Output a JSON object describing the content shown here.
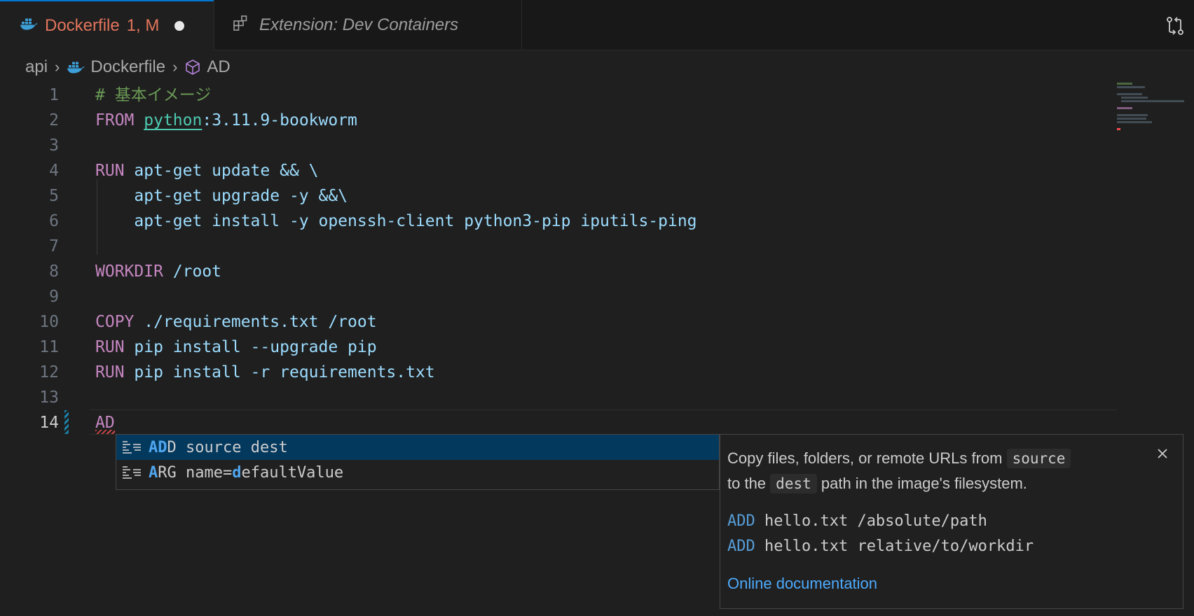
{
  "tabs": [
    {
      "title": "Dockerfile",
      "status": "1, M",
      "icon": "docker-icon",
      "active": true
    },
    {
      "title": "Extension: Dev Containers",
      "icon": "extensions-icon",
      "active": false
    }
  ],
  "breadcrumb": {
    "folder": "api",
    "file": "Dockerfile",
    "symbol": "AD"
  },
  "line_numbers": [
    "1",
    "2",
    "3",
    "4",
    "5",
    "6",
    "7",
    "8",
    "9",
    "10",
    "11",
    "12",
    "13",
    "14"
  ],
  "code": {
    "l1": "# 基本イメージ",
    "l2_kw": "FROM",
    "l2_img": "python",
    "l2_tag": ":3.11.9-bookworm",
    "l4_kw": "RUN",
    "l4_rest": " apt-get update && \\",
    "l5": "    apt-get upgrade -y &&\\",
    "l6": "    apt-get install -y openssh-client python3-pip iputils-ping",
    "l8_kw": "WORKDIR",
    "l8_rest": " /root",
    "l10_kw": "COPY",
    "l10_rest": " ./requirements.txt /root",
    "l11_kw": "RUN",
    "l11_rest": " pip install --upgrade pip",
    "l12_kw": "RUN",
    "l12_rest": " pip install -r requirements.txt",
    "l14": "AD"
  },
  "suggest": {
    "items": [
      {
        "match": "AD",
        "rest_a": "D source dest",
        "icon": "snippet-icon",
        "selected": true
      },
      {
        "match_a": "A",
        "rest_a": "RG name=",
        "match_b": "d",
        "rest_b": "efaultValue",
        "icon": "snippet-icon",
        "selected": false
      }
    ]
  },
  "details": {
    "desc_pre": "Copy files, folders, or remote URLs from",
    "code_source": "source",
    "desc_mid": "to the",
    "code_dest": "dest",
    "desc_post": "path in the image's filesystem.",
    "ex1_kw": "ADD",
    "ex1_rest": " hello.txt /absolute/path",
    "ex2_kw": "ADD",
    "ex2_rest": " hello.txt relative/to/workdir",
    "link": "Online documentation"
  },
  "colors": {
    "accent": "#0078d4",
    "modified": "#e2755c",
    "keyword": "#c586c0",
    "comment": "#6a9955"
  }
}
